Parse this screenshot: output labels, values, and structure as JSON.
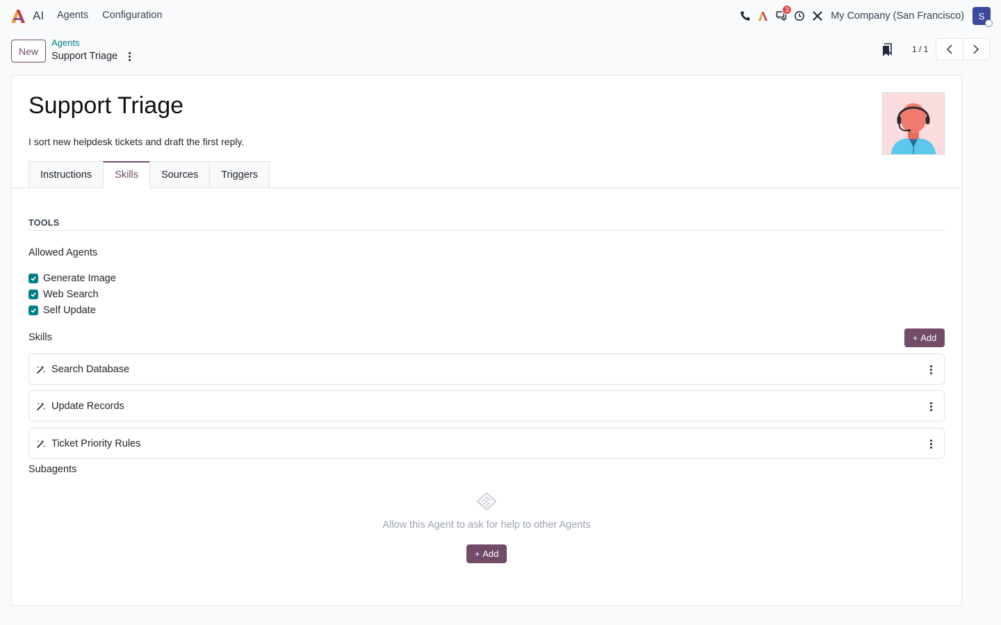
{
  "app": {
    "name": "AI"
  },
  "nav": {
    "items": [
      "Agents",
      "Configuration"
    ]
  },
  "systray": {
    "messages_count": "3",
    "company": "My Company (San Francisco)",
    "user_initial": "S"
  },
  "control_panel": {
    "new_label": "New",
    "breadcrumb_parent": "Agents",
    "breadcrumb_current": "Support Triage",
    "pager": "1 / 1"
  },
  "form": {
    "title": "Support Triage",
    "description": "I sort new helpdesk tickets and draft the first reply.",
    "tabs": [
      "Instructions",
      "Skills",
      "Sources",
      "Triggers"
    ],
    "active_tab": "Skills",
    "tools_heading": "TOOLS",
    "allowed_agents_label": "Allowed Agents",
    "allowed_agents": [
      {
        "label": "Generate Image",
        "checked": true
      },
      {
        "label": "Web Search",
        "checked": true
      },
      {
        "label": "Self Update",
        "checked": true
      }
    ],
    "skills_label": "Skills",
    "add_label": "Add",
    "skills": [
      "Search Database",
      "Update Records",
      "Ticket Priority Rules"
    ],
    "subagents_label": "Subagents",
    "subagents_empty": "Allow this Agent to ask for help to other Agents"
  },
  "colors": {
    "brand": "#714b67",
    "accent": "#017e84",
    "badge": "#e04848"
  }
}
